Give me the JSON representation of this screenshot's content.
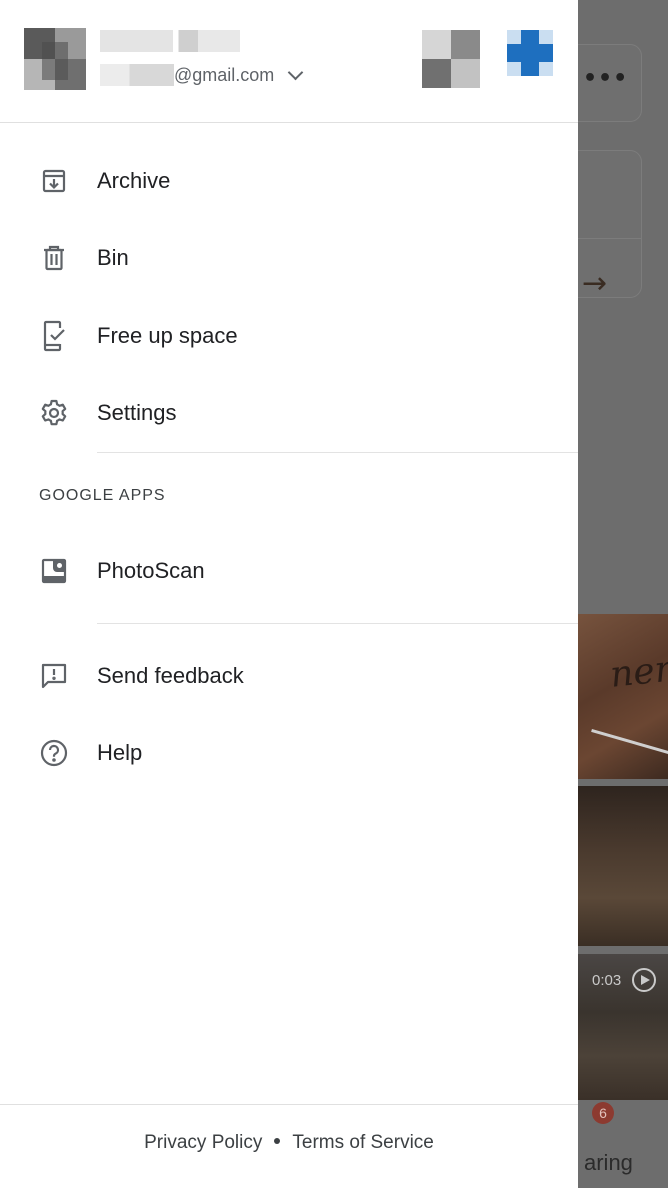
{
  "account": {
    "email_suffix": "@gmail.com"
  },
  "menu": {
    "items": [
      {
        "label": "Archive",
        "icon": "archive-icon"
      },
      {
        "label": "Bin",
        "icon": "trash-icon"
      },
      {
        "label": "Free up space",
        "icon": "phone-check-icon"
      },
      {
        "label": "Settings",
        "icon": "gear-icon"
      }
    ],
    "google_apps_title": "GOOGLE APPS",
    "apps": [
      {
        "label": "PhotoScan",
        "icon": "photoscan-icon"
      }
    ],
    "support": [
      {
        "label": "Send feedback",
        "icon": "feedback-icon"
      },
      {
        "label": "Help",
        "icon": "help-icon"
      }
    ]
  },
  "footer": {
    "privacy": "Privacy Policy",
    "terms": "Terms of Service"
  },
  "background": {
    "video_duration": "0:03",
    "sharing_badge": "6",
    "sharing_label": "aring"
  },
  "colors": {
    "scrim": "#6d6d6d",
    "drawer_bg": "#ffffff",
    "text_primary": "#202124",
    "icon": "#5f6368",
    "avatar_accent": "#1e6fbf"
  }
}
